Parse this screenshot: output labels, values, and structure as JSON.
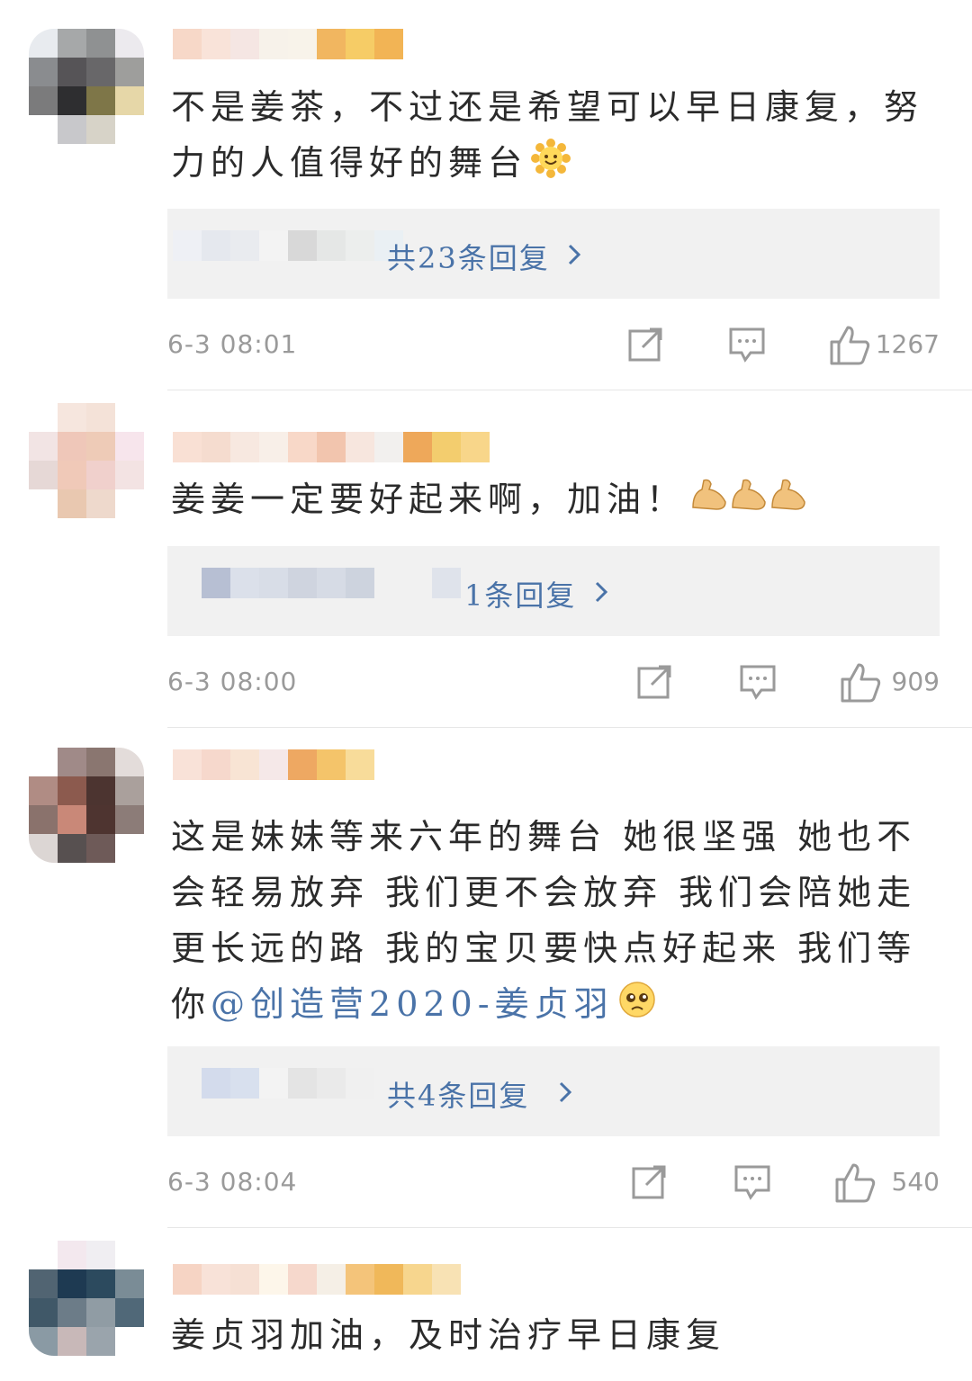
{
  "comments": [
    {
      "text": "不是姜茶，不过还是希望可以早日康复，努力的人值得好的舞台",
      "emoji": "sun-smile",
      "reply_summary": "共23条回复",
      "time": "6-3 08:01",
      "likes": "1267"
    },
    {
      "text": "姜姜一定要好起来啊，加油！",
      "emoji": "flexed-biceps",
      "reply_summary": "1条回复",
      "time": "6-3 08:00",
      "likes": "909"
    },
    {
      "text": "这是妹妹等来六年的舞台 她很坚强 她也不会轻易放弃 我们更不会放弃 我们会陪她走更长远的路 我的宝贝要快点好起来 我们等你",
      "mention": "@创造营2020-姜贞羽",
      "emoji": "pleading-face",
      "reply_summary": "共4条回复",
      "time": "6-3 08:04",
      "likes": "540"
    },
    {
      "text": "姜贞羽加油，及时治疗早日康复"
    }
  ],
  "icons": {
    "repost": "share-icon",
    "comment": "comment-icon",
    "like": "thumbs-up-icon",
    "chevron": "chevron-right-icon"
  },
  "colors": {
    "link": "#4a73a8",
    "meta": "#9a9a9a",
    "reply_bg": "#f1f1f1"
  }
}
